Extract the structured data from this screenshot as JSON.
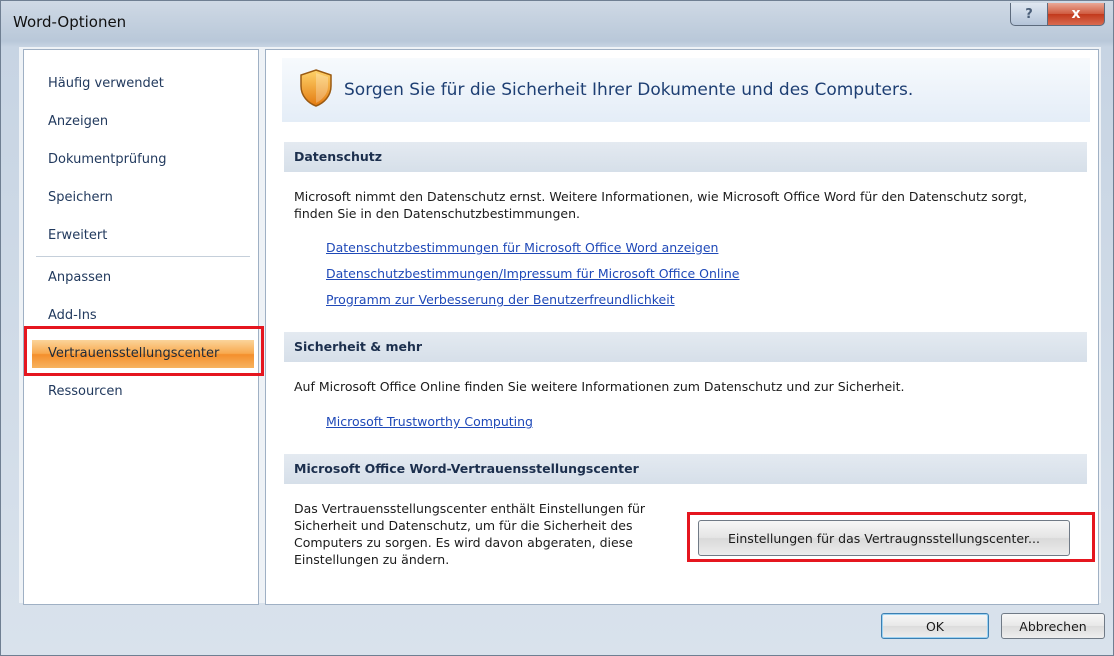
{
  "window": {
    "title": "Word-Optionen",
    "help_label": "?",
    "close_label": "x"
  },
  "sidebar": {
    "items": [
      {
        "label": "Häufig verwendet"
      },
      {
        "label": "Anzeigen"
      },
      {
        "label": "Dokumentprüfung"
      },
      {
        "label": "Speichern"
      },
      {
        "label": "Erweitert"
      },
      {
        "label": "Anpassen"
      },
      {
        "label": "Add-Ins"
      },
      {
        "label": "Vertrauensstellungscenter",
        "selected": true
      },
      {
        "label": "Ressourcen"
      }
    ]
  },
  "main": {
    "banner_text": "Sorgen Sie für die Sicherheit Ihrer Dokumente und des Computers.",
    "sections": [
      {
        "heading": "Datenschutz",
        "text": "Microsoft nimmt den Datenschutz ernst. Weitere Informationen, wie Microsoft Office Word für den Datenschutz sorgt, finden Sie in den Datenschutzbestimmungen.",
        "links": [
          "Datenschutzbestimmungen für Microsoft Office Word anzeigen",
          "Datenschutzbestimmungen/Impressum für Microsoft Office Online",
          "Programm zur Verbesserung der Benutzerfreundlichkeit"
        ]
      },
      {
        "heading": "Sicherheit & mehr",
        "text": "Auf Microsoft Office Online finden Sie weitere Informationen zum Datenschutz und zur Sicherheit.",
        "links": [
          "Microsoft Trustworthy Computing"
        ]
      },
      {
        "heading": "Microsoft Office Word-Vertrauensstellungscenter",
        "text": "Das Vertrauensstellungscenter enthält Einstellungen für Sicherheit und Datenschutz, um für die Sicherheit des Computers zu sorgen. Es wird davon abgeraten, diese Einstellungen zu ändern.",
        "button_label": "Einstellungen für das Vertraugnsstellungscenter..."
      }
    ]
  },
  "footer": {
    "ok_label": "OK",
    "cancel_label": "Abbrechen"
  },
  "colors": {
    "selected_nav": "#f8a94f",
    "highlight_box": "#e5161f",
    "link": "#1f49b8"
  },
  "icons": {
    "banner": "shield-icon"
  }
}
